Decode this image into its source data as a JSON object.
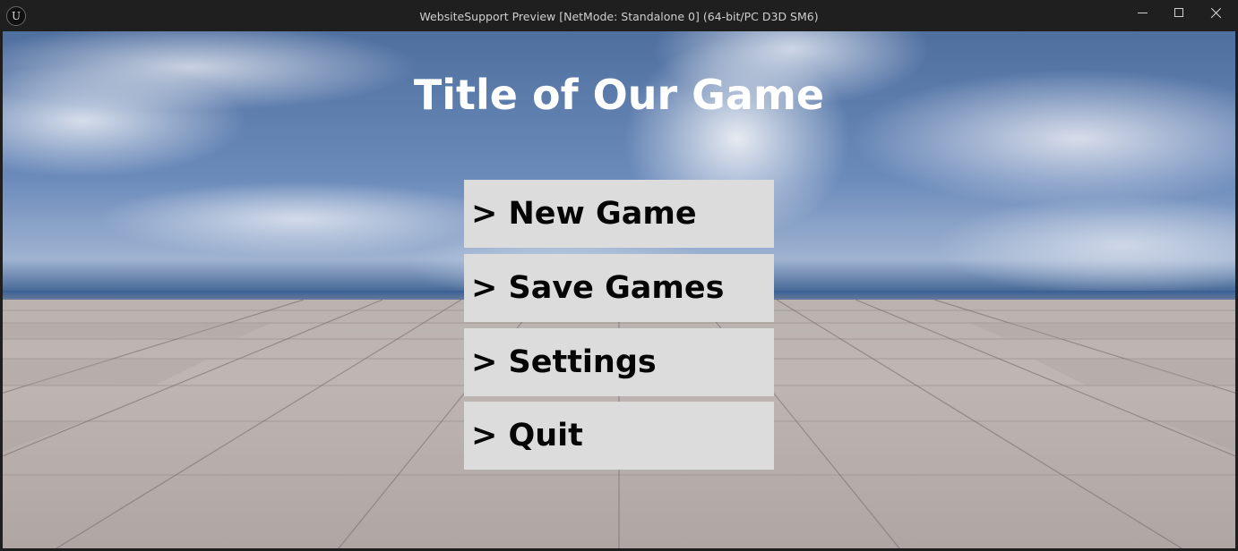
{
  "window": {
    "title": "WebsiteSupport Preview [NetMode: Standalone 0]  (64-bit/PC D3D SM6)",
    "logo_glyph": "U",
    "controls": {
      "minimize_icon": "minimize-icon",
      "maximize_icon": "maximize-icon",
      "close_icon": "close-icon"
    }
  },
  "game": {
    "title": "Title of Our Game",
    "menu": [
      {
        "label": "> New Game"
      },
      {
        "label": "> Save Games"
      },
      {
        "label": "> Settings"
      },
      {
        "label": "> Quit"
      }
    ]
  },
  "colors": {
    "menu_button_bg": "#dcdcdc",
    "menu_button_text": "#050505",
    "title_text": "#ffffff",
    "titlebar_bg": "#1f1f1f"
  }
}
